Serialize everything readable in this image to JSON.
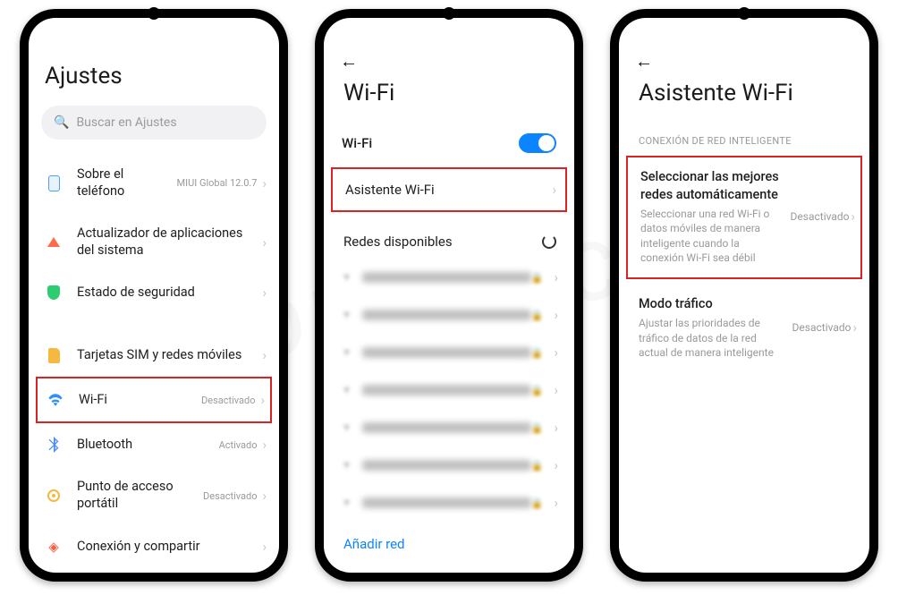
{
  "watermark": "XIAOMIADICTOS",
  "settings": {
    "title": "Ajustes",
    "search_placeholder": "Buscar en Ajustes",
    "items": {
      "about": {
        "label": "Sobre el\nteléfono",
        "sub": "MIUI Global 12.0.7"
      },
      "updater": {
        "label": "Actualizador de aplicaciones del sistema"
      },
      "security": {
        "label": "Estado de seguridad"
      },
      "sim": {
        "label": "Tarjetas SIM y redes móviles"
      },
      "wifi": {
        "label": "Wi-Fi",
        "sub": "Desactivado"
      },
      "bt": {
        "label": "Bluetooth",
        "sub": "Activado"
      },
      "hotspot": {
        "label": "Punto de acceso portátil",
        "sub": "Desactivado"
      },
      "share": {
        "label": "Conexión y compartir"
      }
    }
  },
  "wifi": {
    "title": "Wi-Fi",
    "toggle_label": "Wi-Fi",
    "assistant": "Asistente Wi-Fi",
    "available_header": "Redes disponibles",
    "add_network": "Añadir red"
  },
  "assistant": {
    "title": "Asistente Wi-Fi",
    "section": "CONEXIÓN DE RED INTELIGENTE",
    "best": {
      "title": "Seleccionar las mejores redes automáticamente",
      "desc": "Seleccionar una red Wi-Fi o datos móviles de manera inteligente cuando la conexión Wi-Fi sea débil",
      "state": "Desactivado"
    },
    "traffic": {
      "title": "Modo tráfico",
      "desc": "Ajustar las prioridades de tráfico de datos de la red actual de manera inteligente",
      "state": "Desactivado"
    }
  }
}
